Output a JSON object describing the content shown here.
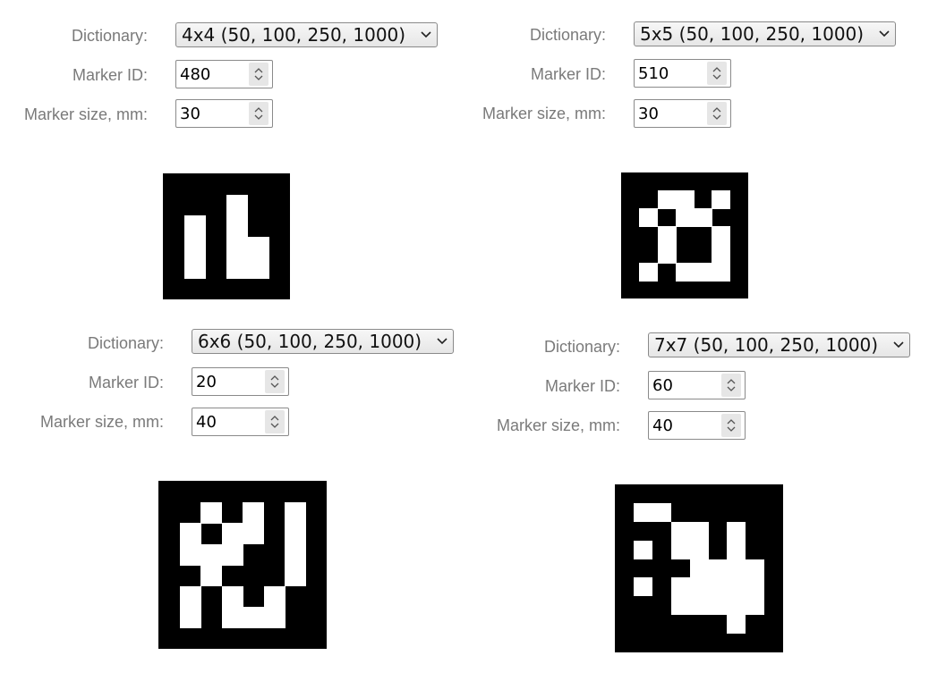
{
  "labels": {
    "dictionary": "Dictionary:",
    "marker_id": "Marker ID:",
    "marker_size": "Marker size, mm:"
  },
  "panels": [
    {
      "dictionary": "4x4 (50, 100, 250, 1000)",
      "marker_id": "480",
      "marker_size": "30"
    },
    {
      "dictionary": "5x5 (50, 100, 250, 1000)",
      "marker_id": "510",
      "marker_size": "30"
    },
    {
      "dictionary": "6x6 (50, 100, 250, 1000)",
      "marker_id": "20",
      "marker_size": "40"
    },
    {
      "dictionary": "7x7 (50, 100, 250, 1000)",
      "marker_id": "60",
      "marker_size": "40"
    }
  ],
  "markers": [
    {
      "bits": [
        "0010",
        "1010",
        "1011",
        "1011"
      ]
    },
    {
      "bits": [
        "01101",
        "10110",
        "01001",
        "01001",
        "10111"
      ]
    },
    {
      "bits": [
        "010101",
        "101101",
        "111001",
        "010001",
        "101010",
        "101110"
      ]
    },
    {
      "bits": [
        "1100000",
        "0011010",
        "1011010",
        "0001111",
        "1011111",
        "0011111",
        "0000010"
      ]
    }
  ],
  "colors": {
    "label": "#7a7a7a",
    "marker_bg": "#000000",
    "marker_bit": "#ffffff"
  }
}
